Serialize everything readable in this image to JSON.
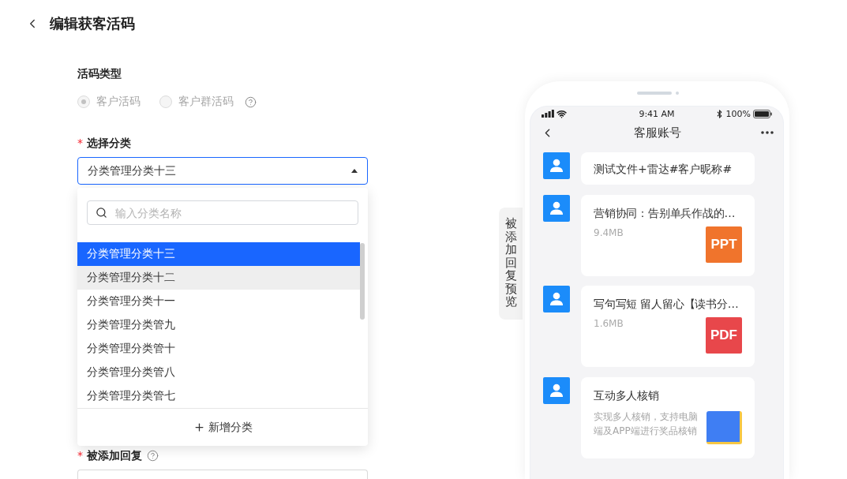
{
  "header": {
    "title": "编辑获客活码"
  },
  "code_type": {
    "label": "活码类型",
    "options": [
      {
        "label": "客户活码",
        "selected": true,
        "disabled": true,
        "help": false
      },
      {
        "label": "客户群活码",
        "selected": false,
        "disabled": true,
        "help": true
      }
    ]
  },
  "category": {
    "required_mark": "*",
    "label": "选择分类",
    "value": "分类管理分类十三",
    "expanded": true,
    "search_placeholder": "输入分类名称",
    "options": [
      {
        "label": "分类管理分类十三",
        "selected": true,
        "hovered": false
      },
      {
        "label": "分类管理分类十二",
        "selected": false,
        "hovered": true
      },
      {
        "label": "分类管理分类十一",
        "selected": false,
        "hovered": false
      },
      {
        "label": "分类管理分类管九",
        "selected": false,
        "hovered": false
      },
      {
        "label": "分类管理分类管十",
        "selected": false,
        "hovered": false
      },
      {
        "label": "分类管理分类管八",
        "selected": false,
        "hovered": false
      },
      {
        "label": "分类管理分类管七",
        "selected": false,
        "hovered": false
      }
    ],
    "add_label": "新增分类"
  },
  "reply": {
    "required_mark": "*",
    "label": "被添加回复",
    "help": true
  },
  "preview_tab": {
    "label": "被添加回复预览"
  },
  "phone": {
    "status_bar": {
      "time": "9:41 AM",
      "battery": "100%"
    },
    "nav_title": "客服账号",
    "messages": [
      {
        "kind": "text",
        "text": "测试文件+雷达#客户昵称#"
      },
      {
        "kind": "file",
        "title": "营销协同：告别单兵作战的…",
        "size": "9.4MB",
        "file_type": "PPT",
        "color": "#f0742c"
      },
      {
        "kind": "file",
        "title": "写句写短 留人留心【读书分…",
        "size": "1.6MB",
        "file_type": "PDF",
        "color": "#e8474b"
      },
      {
        "kind": "link",
        "title": "互动多人核销",
        "description": "实现多人核销，支持电脑端及APP端进行奖品核销"
      }
    ]
  }
}
